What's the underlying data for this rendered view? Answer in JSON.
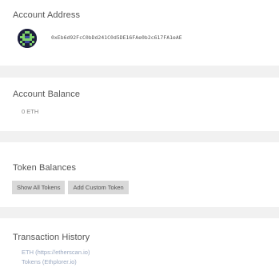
{
  "account": {
    "title": "Account Address",
    "address": "0xEb6d92FcC0bDd241C0d5DE16FAe0b2c617FA1eAE",
    "avatar_icon": "identicon"
  },
  "balance": {
    "title": "Account Balance",
    "value": "0 ETH"
  },
  "tokens": {
    "title": "Token Balances",
    "show_all_label": "Show All Tokens",
    "add_custom_label": "Add Custom Token"
  },
  "history": {
    "title": "Transaction History",
    "links": [
      {
        "label": "ETH (https://etherscan.io)"
      },
      {
        "label": "Tokens (Ethplorer.io)"
      }
    ]
  },
  "colors": {
    "background": "#f1f1f1",
    "card": "#ffffff",
    "button": "#d9d9d9",
    "link": "#9aa8c0",
    "identicon_bg": "#1d1f3d",
    "identicon_fg": "#7fd36b"
  }
}
